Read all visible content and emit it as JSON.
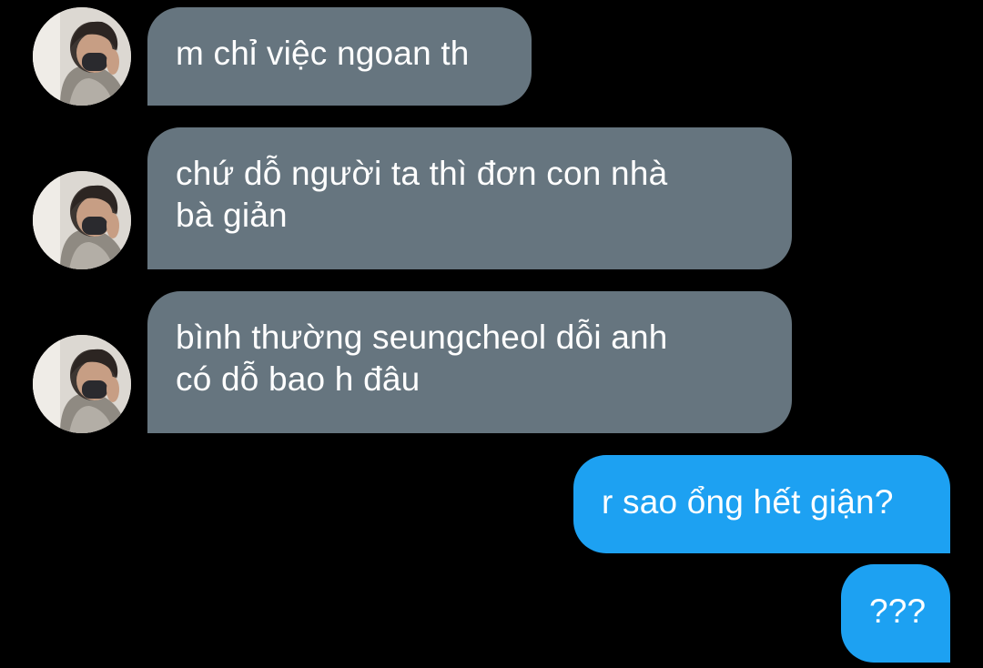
{
  "conversation": {
    "messages": [
      {
        "direction": "incoming",
        "lines": [
          "m chỉ việc ngoan th"
        ],
        "avatar": "contact-avatar"
      },
      {
        "direction": "incoming",
        "lines": [
          "chứ dỗ người ta thì đơn con nhà",
          "bà giản"
        ],
        "avatar": "contact-avatar"
      },
      {
        "direction": "incoming",
        "lines": [
          "bình thường seungcheol dỗi anh",
          "có dỗ bao h đâu"
        ],
        "avatar": "contact-avatar"
      },
      {
        "direction": "outgoing",
        "lines": [
          "r sao ổng hết giận?"
        ]
      },
      {
        "direction": "outgoing",
        "lines": [
          "???"
        ]
      }
    ]
  },
  "colors": {
    "background": "#000000",
    "incoming_bubble": "#66757f",
    "outgoing_bubble": "#1da1f2",
    "text": "#ffffff"
  }
}
